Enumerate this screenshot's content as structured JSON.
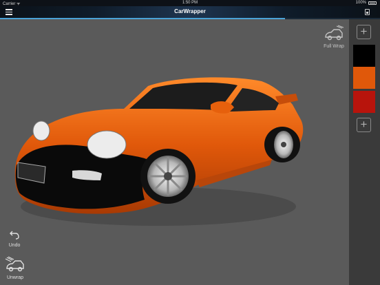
{
  "status_bar": {
    "carrier": "Carrier ᯤ",
    "time": "1:50 PM",
    "battery": "100%"
  },
  "nav": {
    "title": "CarWrapper"
  },
  "tools": {
    "full_wrap_label": "Full Wrap",
    "undo_label": "Undo",
    "unwrap_label": "Unwrap"
  },
  "sidebar": {
    "add_symbol": "+",
    "swatches": [
      {
        "name": "black",
        "color": "#000000"
      },
      {
        "name": "orange",
        "color": "#e0580a"
      },
      {
        "name": "red",
        "color": "#b8140c"
      }
    ]
  },
  "icons": [
    "menu-icon",
    "share-icon",
    "full-wrap-icon",
    "undo-icon",
    "unwrap-icon",
    "plus-icon"
  ],
  "colors": {
    "accent": "#4aa3d8",
    "car_body": "#e0580a",
    "viewport_bg": "#5a5a5a",
    "sidebar_bg": "#3a3a3a"
  }
}
